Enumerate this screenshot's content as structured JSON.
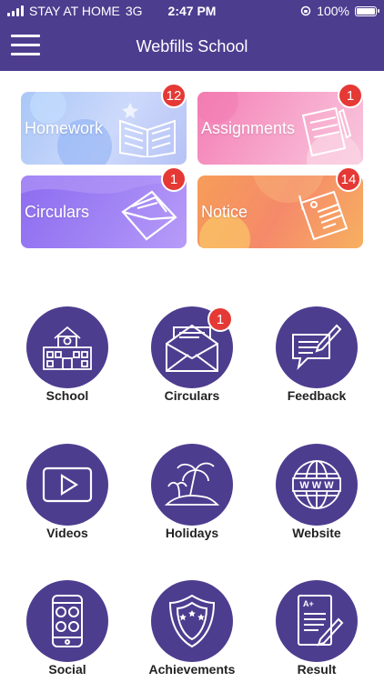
{
  "status_bar": {
    "carrier": "STAY AT HOME",
    "network": "3G",
    "time": "2:47 PM",
    "battery": "100%"
  },
  "header": {
    "title": "Webfills School"
  },
  "cards": [
    {
      "label": "Homework",
      "badge": "12"
    },
    {
      "label": "Assignments",
      "badge": "1"
    },
    {
      "label": "Circulars",
      "badge": "1"
    },
    {
      "label": "Notice",
      "badge": "14"
    }
  ],
  "grid": [
    {
      "label": "School",
      "icon": "school-icon"
    },
    {
      "label": "Circulars",
      "icon": "envelope-icon",
      "badge": "1"
    },
    {
      "label": "Feedback",
      "icon": "feedback-icon"
    },
    {
      "label": "Videos",
      "icon": "play-icon"
    },
    {
      "label": "Holidays",
      "icon": "palm-island-icon"
    },
    {
      "label": "Website",
      "icon": "globe-www-icon"
    },
    {
      "label": "Social",
      "icon": "phone-social-icon"
    },
    {
      "label": "Achievements",
      "icon": "shield-stars-icon"
    },
    {
      "label": "Result",
      "icon": "report-card-icon"
    }
  ],
  "colors": {
    "primary": "#4d3d8f",
    "badge": "#e53935"
  }
}
